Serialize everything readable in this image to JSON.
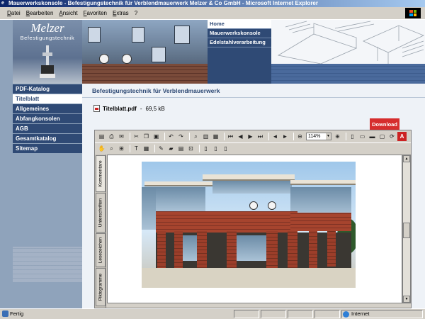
{
  "window": {
    "title": "Mauerwerkskonsole - Befestigungstechnik für Verblendmauerwerk Melzer & Co GmbH - Microsoft Internet Explorer"
  },
  "menubar": {
    "items": [
      "Datei",
      "Bearbeiten",
      "Ansicht",
      "Favoriten",
      "Extras",
      "?"
    ]
  },
  "site": {
    "logo_title": "Melzer",
    "logo_subtitle": "Befestigungstechnik",
    "top_nav": [
      {
        "label": "Home",
        "active": true
      },
      {
        "label": "Mauerwerkskonsole",
        "active": false
      },
      {
        "label": "Edelstahlverarbeitung",
        "active": false
      }
    ],
    "side_nav": [
      {
        "label": "PDF-Katalog",
        "active": false
      },
      {
        "label": "Titelblatt",
        "active": true
      },
      {
        "label": "Allgemeines",
        "active": false
      },
      {
        "label": "Abfangkonsolen",
        "active": false
      },
      {
        "label": "AGB",
        "active": false
      },
      {
        "label": "Gesamtkatalog",
        "active": false
      },
      {
        "label": "Sitemap",
        "active": false
      }
    ],
    "heading": "Befestigungstechnik für Verblendmauerwerk",
    "file": {
      "name": "Titelblatt.pdf",
      "separator": "-",
      "size": "69,5 kB"
    },
    "download_label": "Download"
  },
  "reader": {
    "zoom": "114%",
    "side_tabs": [
      "Kommentare",
      "Unterschriften",
      "Lesezeichen",
      "Piktogramme"
    ],
    "active_tab": "Kommentare"
  },
  "statusbar": {
    "status": "Fertig",
    "zone": "Internet"
  },
  "colors": {
    "brand_navy": "#2f4a75",
    "sidebar_blue": "#8fa3bb",
    "download_red": "#d62d2d"
  }
}
